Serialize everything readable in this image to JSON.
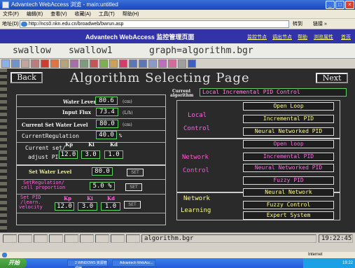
{
  "window": {
    "title": "Advantech WebAccess 浏览 - main:untitled"
  },
  "menu": [
    "文件(F)",
    "编辑(E)",
    "查看(V)",
    "收藏(A)",
    "工具(T)",
    "帮助(H)"
  ],
  "address": {
    "label": "地址(D)",
    "url": "http://ncs0.nkn.edu.cn/broadweb/bwrun.asp",
    "go": "转到",
    "links": "链接 »"
  },
  "banner": {
    "title": "Advantech WebAccess 监控管理页面",
    "links": [
      "监控节点",
      "调出节点",
      "帮助",
      "浏览属性",
      "首页"
    ]
  },
  "filebar": {
    "node": "swallow",
    "project": "swallow1",
    "graph": "graph=algorithm.bgr"
  },
  "page": {
    "back": "Back",
    "title": "Algorithm Selecting Page",
    "next": "Next"
  },
  "left": {
    "water_level_label": "Water Lever",
    "water_level": "80.6",
    "water_level_unit": "(cm)",
    "input_flux_label": "Input Flux",
    "input_flux": "73.4",
    "input_flux_unit": "(L/h)",
    "set_water_label": "Current Set Water Level",
    "set_water": "80.0",
    "set_water_unit": "(cm)",
    "cur_reg_label": "CurrentRegulation",
    "cur_reg": "40.0",
    "cur_reg_unit": "%",
    "pid_label_1": "Current set/",
    "pid_label_2": "adjust PID",
    "kp_label": "Kp",
    "ki_label": "Ki",
    "kd_label": "Kd",
    "kp": "12.0",
    "ki": "3.0",
    "kd": "1.0",
    "set_level_label": "Set Water Level",
    "set_level": "80.0",
    "set_reg_label_1": "SetRegulation/",
    "set_reg_label_2": "cell proportion",
    "set_reg": "5.0 %",
    "set_pid_label_1": "Set PID",
    "set_pid_label_2": "/learn.",
    "set_pid_label_3": "velocity",
    "set_kp": "12.0",
    "set_ki": "3.0",
    "set_kd": "1.0",
    "set_btn": "SET"
  },
  "right": {
    "current_label_1": "Current",
    "current_label_2": "algorithm",
    "current_value": "Local   Incremental PID Control",
    "local_label_1": "Local",
    "local_label_2": "Control",
    "local_opts": [
      "Open Loop",
      "Incremental PID",
      "Neural Networked PID"
    ],
    "network_label_1": "Network",
    "network_label_2": "Control",
    "network_opts": [
      "Open loop",
      "Incremental PID",
      "Neural Networked PID",
      "Fuzzy PID"
    ],
    "learning_label_1": "Network",
    "learning_label_2": "Learning",
    "learning_opts": [
      "Neural Network",
      "Fuzzy Control",
      "Expert System"
    ]
  },
  "status": {
    "file": "algorithm.bgr",
    "time": "19:22:45"
  },
  "ie_status": {
    "zone": "Internet"
  },
  "taskbar": {
    "start": "开始",
    "tasks": [
      "2 WINDOWS 资源管理器",
      "Advantech WebAcc..."
    ],
    "clock": "19:22"
  }
}
